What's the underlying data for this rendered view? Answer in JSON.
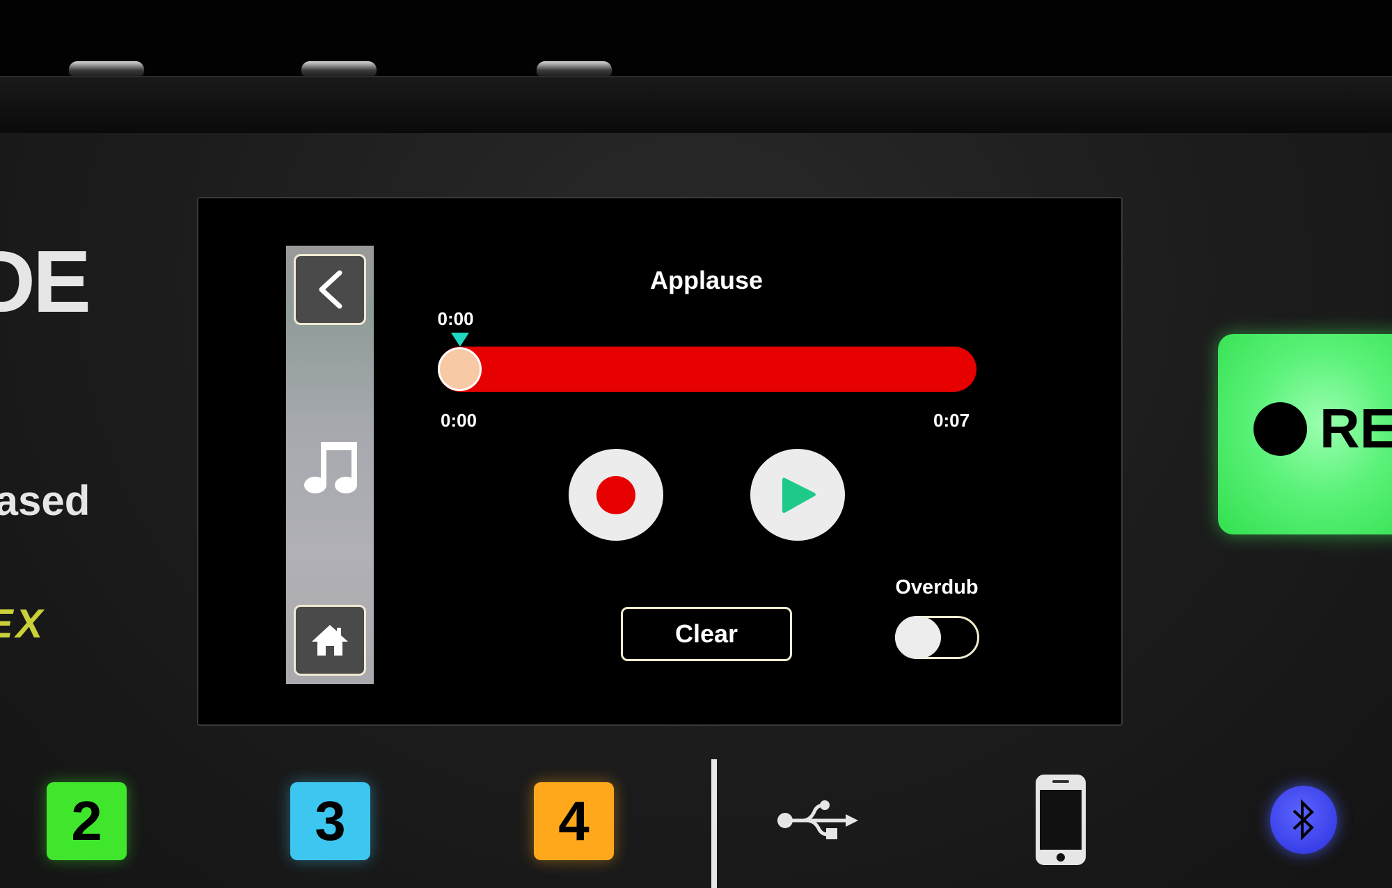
{
  "device": {
    "brand_partial": "DE",
    "tagline_partial": "iased",
    "model_partial": "EX",
    "rec_button_label": "REC",
    "colors": {
      "rec_green": "#5cf27a",
      "pad2": "#3fe62c",
      "pad3": "#3dc6f0",
      "pad4": "#ffa81c",
      "bluetooth": "#3a40e8"
    },
    "pads": [
      {
        "label": "2"
      },
      {
        "label": "3"
      },
      {
        "label": "4"
      }
    ],
    "connection_icons": [
      "usb-icon",
      "smartphone-icon",
      "bluetooth-icon"
    ]
  },
  "screen": {
    "sidebar": {
      "back_icon": "chevron-left-icon",
      "section_icon": "music-note-icon",
      "home_icon": "home-icon"
    },
    "title": "Applause",
    "playhead_time": "0:00",
    "start_time": "0:00",
    "end_time": "0:07",
    "progress": 0.0,
    "colors": {
      "track": "#e60000",
      "thumb": "#f8c9a5",
      "marker": "#1ed8c0",
      "record_dot": "#e60000",
      "play_triangle": "#1ec98a"
    },
    "record_icon": "record-icon",
    "play_icon": "play-icon",
    "clear_label": "Clear",
    "overdub_label": "Overdub",
    "overdub_on": false
  }
}
